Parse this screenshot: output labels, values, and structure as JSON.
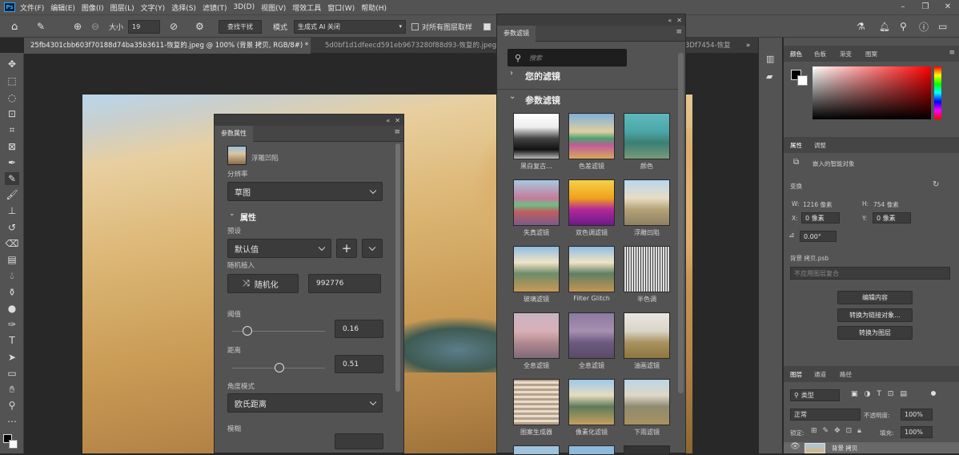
{
  "app": {
    "logo": "Ps"
  },
  "menu": [
    "文件(F)",
    "编辑(E)",
    "图像(I)",
    "图层(L)",
    "文字(Y)",
    "选择(S)",
    "滤镜(T)",
    "3D(D)",
    "视图(V)",
    "增效工具",
    "窗口(W)",
    "帮助(H)"
  ],
  "options": {
    "size_label": "大小",
    "size_value": "19",
    "find_gap": "查找干扰",
    "mode_label": "模式",
    "mode_value": "生成式 AI 关闭",
    "sample_all": "对所有图层取样"
  },
  "tabs": {
    "active": "25fb4301cbb603f70188d74ba35b3611-恢复的.jpeg @ 100% (背景 拷贝, RGB/8#) *",
    "second": "5d0bf1d1dfeecd591eb9673280f88d93-恢复的.jpeg",
    "third": "3Df7454-恢复",
    "overflow": "»"
  },
  "properties_panel": {
    "title": "参数属性",
    "filter_name": "浮雕凹陷",
    "resolution_label": "分辨率",
    "resolution_value": "草图",
    "section": "属性",
    "preset_label": "预设",
    "preset_value": "默认值",
    "seed_label": "随机植入",
    "randomize": "随机化",
    "seed_value": "992776",
    "threshold_label": "阈值",
    "threshold_value": "0.16",
    "threshold_level": 0.16,
    "distance_label": "距离",
    "distance_value": "0.51",
    "distance_level": 0.51,
    "angle_label": "角度模式",
    "angle_value": "欧氏距离",
    "blur_label": "模糊"
  },
  "filters_panel": {
    "title": "参数滤镜",
    "search_placeholder": "搜索",
    "your_filters": "您的滤镜",
    "param_filters": "参数滤镜",
    "items": [
      "黑白复古...",
      "色差滤镜",
      "颜色",
      "失真滤镜",
      "双色调滤镜",
      "浮雕凹陷",
      "玻璃滤镜",
      "Filter Glitch",
      "半色调",
      "全息滤镜",
      "全息滤镜",
      "油画滤镜",
      "图案生成器",
      "像素化滤镜",
      "下雨滤镜"
    ]
  },
  "color_panel": {
    "tabs": [
      "颜色",
      "色板",
      "渐变",
      "图案"
    ],
    "hue_color": "#ff0000"
  },
  "props_right": {
    "tabs": [
      "属性",
      "调整"
    ],
    "smart_object": "嵌入的智能对象",
    "transform": "变换",
    "w_label": "W:",
    "w_value": "1216 像素",
    "h_label": "H:",
    "h_value": "754 像素",
    "x_label": "X:",
    "x_value": "0 像素",
    "y_label": "Y:",
    "y_value": "0 像素",
    "angle_value": "0.00°",
    "layer_file": "背景 拷贝.psb",
    "comp": "不应用图层复合",
    "edit_contents": "编辑内容",
    "convert_linked": "转换为链接对象...",
    "convert_layers": "转换为图层"
  },
  "layers_panel": {
    "tabs": [
      "图层",
      "通道",
      "路径"
    ],
    "kind": "类型",
    "blend": "正常",
    "opacity_label": "不透明度:",
    "opacity_value": "100%",
    "lock_label": "锁定:",
    "fill_label": "填充:",
    "fill_value": "100%",
    "layer_name": "背景 拷贝"
  }
}
